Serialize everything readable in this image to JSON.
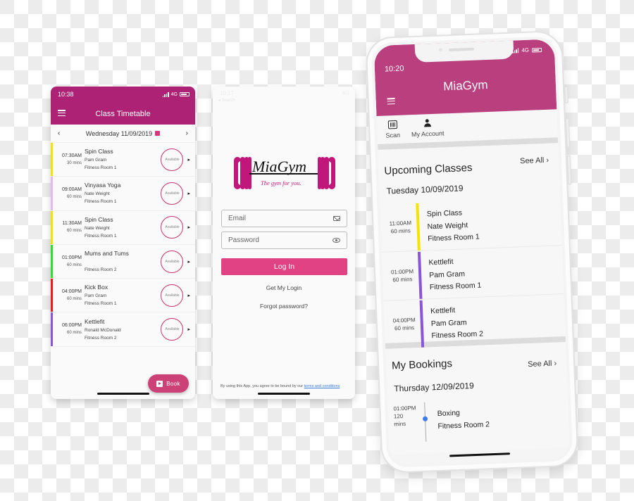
{
  "colors": {
    "brand": "#ad2274",
    "home_header": "#ba3f7e",
    "login_button": "#e14283",
    "book_button": "#cc4276",
    "available_ring": "#c8306a"
  },
  "timetable": {
    "status": {
      "time": "10:38",
      "network": "4G"
    },
    "title": "Class Timetable",
    "menu_icon": "hamburger-icon",
    "date_nav": {
      "prev_icon": "chevron-left-icon",
      "date": "Wednesday  11/09/2019",
      "calendar_icon": "calendar-icon",
      "next_icon": "chevron-right-icon"
    },
    "classes": [
      {
        "time": "07:30AM",
        "duration": "30 mins",
        "name": "Spin Class",
        "instructor": "Pam Gram",
        "room": "Fitness Room 1",
        "status": "Available",
        "color": "#f5e400"
      },
      {
        "time": "09:00AM",
        "duration": "60 mins",
        "name": "Vinyasa Yoga",
        "instructor": "Nate Weight",
        "room": "Fitness Room 1",
        "status": "Available",
        "color": "#e6b8f0"
      },
      {
        "time": "11:30AM",
        "duration": "60 mins",
        "name": "Spin Class",
        "instructor": "Nate Weight",
        "room": "Fitness Room 1",
        "status": "Available",
        "color": "#f5e400"
      },
      {
        "time": "01:00PM",
        "duration": "60 mins",
        "name": "Mums and Tums",
        "instructor": "",
        "room": "Fitness Room 2",
        "status": "Available",
        "color": "#2ee02e"
      },
      {
        "time": "04:00PM",
        "duration": "60 mins",
        "name": "Kick Box",
        "instructor": "Pam Gram",
        "room": "Fitness Room 1",
        "status": "Available",
        "color": "#f01818"
      },
      {
        "time": "06:00PM",
        "duration": "60 mins",
        "name": "Kettlefit",
        "instructor": "Ronald McDonald",
        "room": "Fitness Room 2",
        "status": "Available",
        "color": "#8a55d6"
      }
    ],
    "book_button": "Book"
  },
  "login": {
    "status": {
      "time": "10:17",
      "back": "◂ Search",
      "network": "4G"
    },
    "logo": {
      "name": "MiaGym",
      "tagline": "The gym for you."
    },
    "email": {
      "placeholder": "Email",
      "value": ""
    },
    "password": {
      "placeholder": "Password",
      "value": ""
    },
    "login_button": "Log In",
    "get_login": "Get My Login",
    "forgot": "Forgot password?",
    "terms_prefix": "By using this App, you agree to be bound by our ",
    "terms_link": "terms and conditions"
  },
  "home": {
    "status": {
      "time": "10:20",
      "network": "4G"
    },
    "title": "MiaGym",
    "quick_actions": [
      {
        "label": "Scan",
        "icon": "barcode-scan-icon"
      },
      {
        "label": "My Account",
        "icon": "account-icon"
      }
    ],
    "upcoming": {
      "title": "Upcoming Classes",
      "see_all": "See All",
      "day": "Tuesday  10/09/2019",
      "classes": [
        {
          "time": "11:00AM",
          "duration": "60 mins",
          "name": "Spin Class",
          "instructor": "Nate Weight",
          "room": "Fitness Room 1",
          "color": "#f5e400"
        },
        {
          "time": "01:00PM",
          "duration": "60 mins",
          "name": "Kettlefit",
          "instructor": "Pam Gram",
          "room": "Fitness Room 1",
          "color": "#8a55d6"
        },
        {
          "time": "04:00PM",
          "duration": "60 mins",
          "name": "Kettlefit",
          "instructor": "Pam Gram",
          "room": "Fitness Room 2",
          "color": "#8a55d6"
        }
      ]
    },
    "bookings": {
      "title": "My Bookings",
      "see_all": "See All",
      "day": "Thursday  12/09/2019",
      "items": [
        {
          "time": "01:00PM",
          "duration": "120 mins",
          "name": "Boxing",
          "room": "Fitness Room 2",
          "dot_color": "#3d7cf0"
        }
      ]
    }
  }
}
